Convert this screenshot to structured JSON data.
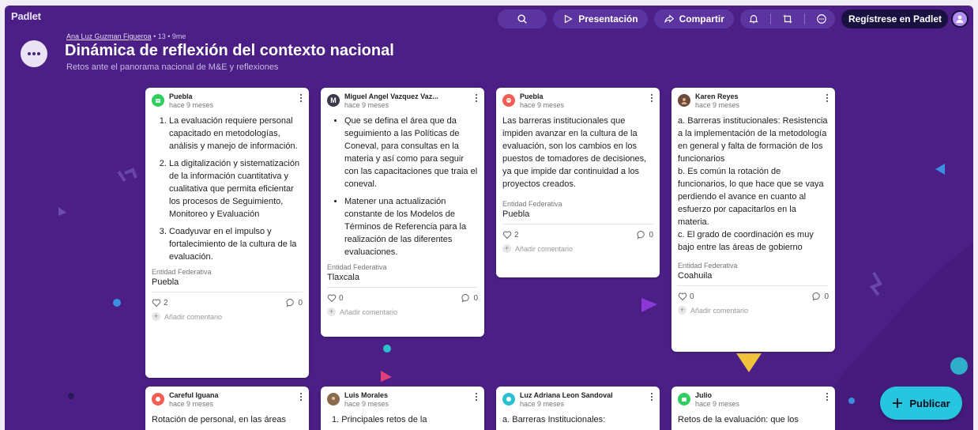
{
  "app": {
    "logo": "Padlet"
  },
  "topbar": {
    "search_icon": "search-icon",
    "presentation_label": "Presentación",
    "share_label": "Compartir",
    "register_label": "Regístrese en Padlet"
  },
  "header": {
    "author": "Ana Luz Guzman Figueroa",
    "meta": "• 13 • 9me",
    "title": "Dinámica de reflexión del contexto nacional",
    "subtitle": "Retos ante el panorama nacional de M&E y reflexiones"
  },
  "colors": {
    "board": "#4b1f86",
    "accent": "#26c6e0",
    "card": "#ffffff"
  },
  "cards": [
    {
      "author": "Puebla",
      "time": "hace 9 meses",
      "avatar_color": "#2fcf5e",
      "items": [
        "La evaluación requiere personal capacitado en metodologías, análisis y manejo de información.",
        "La digitalización y sistematización de la información cuantitativa y cualitativa que permita eficientar los procesos de Seguimiento, Monitoreo y Evaluación",
        "Coadyuvar en el impulso y fortalecimiento de la cultura de la evaluación."
      ],
      "field_label": "Entidad Federativa",
      "field_value": "Puebla",
      "likes": "2",
      "comments": "0",
      "add_comment": "Añadir comentario"
    },
    {
      "author": "Miguel Angel Vazquez Vaz...",
      "time": "hace 9 meses",
      "avatar_color": "#3a3a4a",
      "avatar_letter": "M",
      "items": [
        "Que se defina el área que da seguimiento a las Políticas de Coneval, para consultas en la materia y así como para seguir con las capacitaciones que traia el coneval.",
        "Matener una actualización constante de los Modelos de Términos de Referencia para la realización de las diferentes evaluaciones."
      ],
      "field_label": "Entidad Federativa",
      "field_value": "Tlaxcala",
      "likes": "0",
      "comments": "0",
      "add_comment": "Añadir comentario"
    },
    {
      "author": "Puebla",
      "time": "hace 9 meses",
      "avatar_color": "#f25c54",
      "text": "Las barreras institucionales que impiden avanzar en la cultura de la evaluación, son los cambios en los puestos de tomadores de decisiones, ya que impide dar continuidad a los proyectos creados.",
      "field_label": "Entidad Federativa",
      "field_value": "Puebla",
      "likes": "2",
      "comments": "0",
      "add_comment": "Añadir comentario"
    },
    {
      "author": "Karen Reyes",
      "time": "hace 9 meses",
      "avatar_color": "#6b4a3a",
      "lines": [
        "a. Barreras institucionales: Resistencia a la implementación de la metodología en general y falta de formación de los funcionarios",
        "b. Es común la rotación de funcionarios, lo que hace que se vaya perdiendo el avance en cuanto al esfuerzo por capacitarlos en la materia.",
        "c. El grado de coordinación es muy bajo entre las áreas de gobierno"
      ],
      "field_label": "Entidad Federativa",
      "field_value": "Coahuila",
      "likes": "0",
      "comments": "0",
      "add_comment": "Añadir comentario"
    },
    {
      "author": "Careful Iguana",
      "time": "hace 9 meses",
      "avatar_color": "#f25c54",
      "text": "Rotación de personal, en las áreas"
    },
    {
      "author": "Luis Morales",
      "time": "hace 9 meses",
      "avatar_color": "#8a6a4a",
      "text": "1. Principales retos de la"
    },
    {
      "author": "Luz Adriana Leon Sandoval",
      "time": "hace 9 meses",
      "avatar_color": "#2bbfd0",
      "text": "a. Barreras Institucionales:"
    },
    {
      "author": "Julio",
      "time": "hace 9 meses",
      "avatar_color": "#2fcf5e",
      "text": "Retos de la evaluación: que los"
    }
  ],
  "publish_label": "Publicar"
}
